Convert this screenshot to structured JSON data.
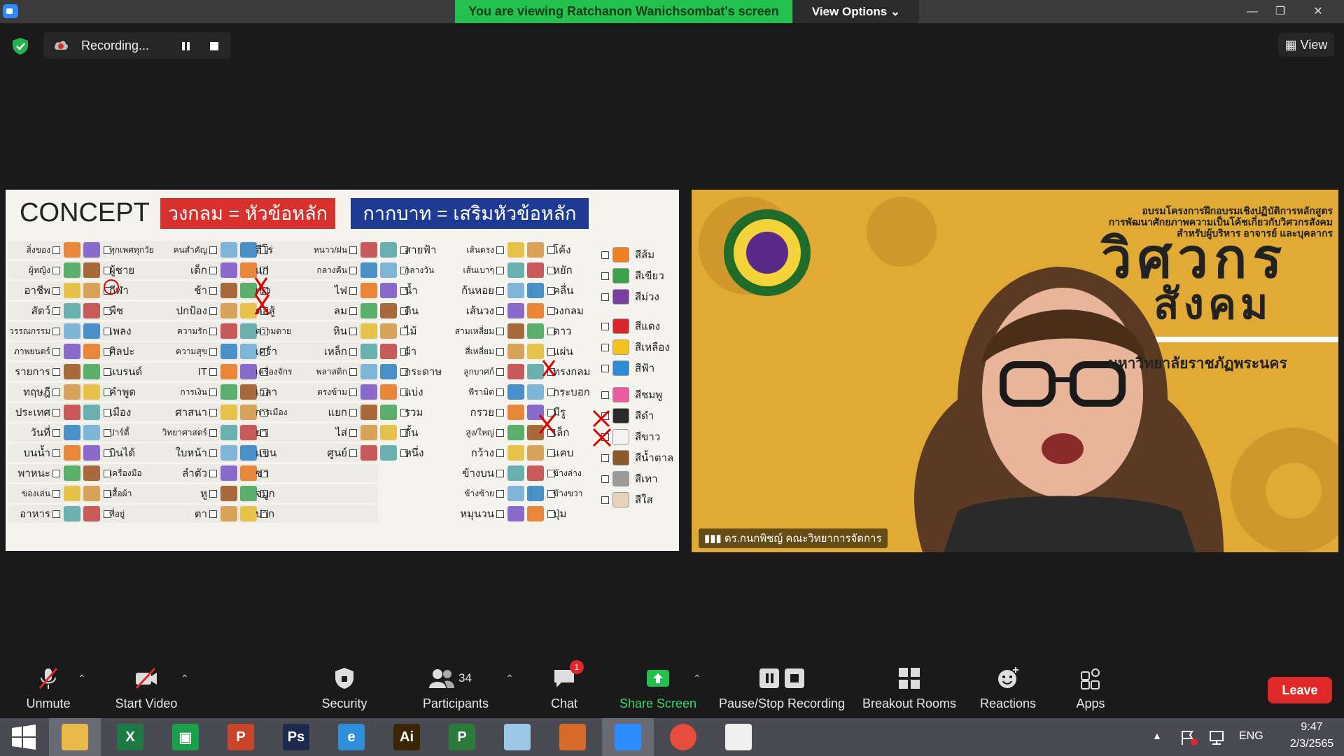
{
  "titlebar": {
    "banner": "You are viewing Ratchanon Wanichsombat's screen",
    "view_options": "View Options ⌄",
    "minimize": "—",
    "restore": "❐",
    "close": "✕"
  },
  "recording": {
    "label": "Recording...",
    "view": "View"
  },
  "slide": {
    "title": "CONCEPT",
    "red_heading": "วงกลม = หัวข้อหลัก",
    "blue_heading": "กากบาท = เสริมหัวข้อหลัก",
    "rows": [
      [
        "สิ่งของ",
        "ทุกเพศทุกวัย",
        "คนสำคัญ",
        "ฮีโร่",
        "หนาว/ฝน",
        "สายฟ้า",
        "เส้นตรง",
        "โค้ง"
      ],
      [
        "ผู้หญิง",
        "ผู้ชาย",
        "เด็ก",
        "แก่",
        "กลางคืน",
        "กลางวัน",
        "เส้นเบาๆ",
        "หยัก"
      ],
      [
        "อาชีพ",
        "กีฬา",
        "ช้า",
        "เร็ว",
        "ไฟ",
        "น้ำ",
        "ก้นหอย",
        "คลื่น"
      ],
      [
        "สัตว์",
        "พืช",
        "ปกป้อง",
        "ต่อสู้",
        "ลม",
        "ดิน",
        "เส้นวง",
        "วงกลม"
      ],
      [
        "วรรณกรรม",
        "เพลง",
        "ความรัก",
        "ความตาย",
        "หิน",
        "ไม้",
        "สามเหลี่ยม",
        "ดาว"
      ],
      [
        "ภาพยนตร์",
        "ศิลปะ",
        "ความสุข",
        "เศร้า",
        "เหล็ก",
        "ผ้า",
        "สี่เหลี่ยม",
        "แผ่น"
      ],
      [
        "รายการ",
        "แบรนด์",
        "IT",
        "เครื่องจักร",
        "พลาสติก",
        "กระดาษ",
        "ลูกบาศก์",
        "ทรงกลม"
      ],
      [
        "ทฤษฎี",
        "คำพูด",
        "การเงิน",
        "เวลา",
        "ตรงข้าม",
        "แบ่ง",
        "พีรามิด",
        "กระบอก"
      ],
      [
        "ประเทศ",
        "เมือง",
        "ศาสนา",
        "การเมือง",
        "แยก",
        "รวม",
        "กรวย",
        "มีรู"
      ],
      [
        "วันที่",
        "ปาร์ตี้",
        "วิทยาศาสตร์",
        "ยา",
        "ไส่",
        "กั้น",
        "สูง/ใหญ่",
        "เล็ก"
      ],
      [
        "บนน้ำ",
        "บินได้",
        "ใบหน้า",
        "แขน",
        "ศูนย์",
        "หนึ่ง",
        "กว้าง",
        "แคบ"
      ],
      [
        "พาหนะ",
        "เครื่องมือ",
        "ลำตัว",
        "ขา",
        "",
        "",
        "ข้างบน",
        "ข้างล่าง"
      ],
      [
        "ของเล่น",
        "เสื้อผ้า",
        "หู",
        "จมูก",
        "",
        "",
        "ข้างซ้าย",
        "ข้างขวา"
      ],
      [
        "อาหาร",
        "ที่อยู่",
        "ตา",
        "ปาก",
        "",
        "",
        "หมุนวน",
        "ปุ่ม"
      ]
    ],
    "colors": [
      {
        "label": "สีส้ม",
        "hex": "#f07f22"
      },
      {
        "label": "สีเขียว",
        "hex": "#3aa34a"
      },
      {
        "label": "สีม่วง",
        "hex": "#7b3fa0"
      },
      {
        "label": "สีแดง",
        "hex": "#d9262b"
      },
      {
        "label": "สีเหลือง",
        "hex": "#f4c21c"
      },
      {
        "label": "สีฟ้า",
        "hex": "#2e8bd6"
      },
      {
        "label": "สีชมพู",
        "hex": "#ec5aa0"
      },
      {
        "label": "สีดำ",
        "hex": "#2a2a2a"
      },
      {
        "label": "สีขาว",
        "hex": "#f4f4f4"
      },
      {
        "label": "สีน้ำตาล",
        "hex": "#8a5a2b"
      },
      {
        "label": "สีเทา",
        "hex": "#9a9a9a"
      },
      {
        "label": "สีใส",
        "hex": "#e8d2b8"
      }
    ]
  },
  "speaker": {
    "name": "ดร.กนกพิชญ์ คณะวิทยาการจัดการ",
    "banner_line1": "อบรมโครงการฝึกอบรมเชิงปฏิบัติการหลักสูตร",
    "banner_line2": "การพัฒนาศักยภาพความเป็นโค้ชเกี่ยวกับวิศวกรสังคม",
    "banner_line3": "สำหรับผู้บริหาร อาจารย์ และบุคลากร",
    "big_title_1": "วิศวกร",
    "big_title_2": "สังคม",
    "university": "มหาวิทยาลัยราชภัฏพระนคร"
  },
  "toolbar": {
    "unmute": "Unmute",
    "start_video": "Start Video",
    "security": "Security",
    "participants": "Participants",
    "participants_count": "34",
    "chat": "Chat",
    "chat_badge": "1",
    "share_screen": "Share Screen",
    "pause_stop": "Pause/Stop Recording",
    "breakout": "Breakout Rooms",
    "reactions": "Reactions",
    "apps": "Apps",
    "leave": "Leave"
  },
  "taskbar": {
    "apps": [
      {
        "name": "file-explorer",
        "label": "",
        "color": "#e8b84a"
      },
      {
        "name": "excel",
        "label": "X",
        "color": "#1d7a45"
      },
      {
        "name": "store",
        "label": "▣",
        "color": "#1aa04a"
      },
      {
        "name": "powerpoint",
        "label": "P",
        "color": "#c8452a"
      },
      {
        "name": "photoshop",
        "label": "Ps",
        "color": "#1b2a4d"
      },
      {
        "name": "internet-explorer",
        "label": "e",
        "color": "#2f8fd8"
      },
      {
        "name": "illustrator",
        "label": "Ai",
        "color": "#3a2506"
      },
      {
        "name": "project",
        "label": "P",
        "color": "#2b7a3a"
      },
      {
        "name": "notepad-app",
        "label": "",
        "color": "#9cc8e8"
      },
      {
        "name": "photoscape",
        "label": "",
        "color": "#d86a2a"
      },
      {
        "name": "zoom",
        "label": "",
        "color": "#2d8cff"
      },
      {
        "name": "chrome",
        "label": "",
        "color": "#e84c3d"
      },
      {
        "name": "photos",
        "label": "",
        "color": "#f0f0f0"
      }
    ],
    "lang": "ENG",
    "time": "9:47",
    "date": "2/3/2565"
  }
}
